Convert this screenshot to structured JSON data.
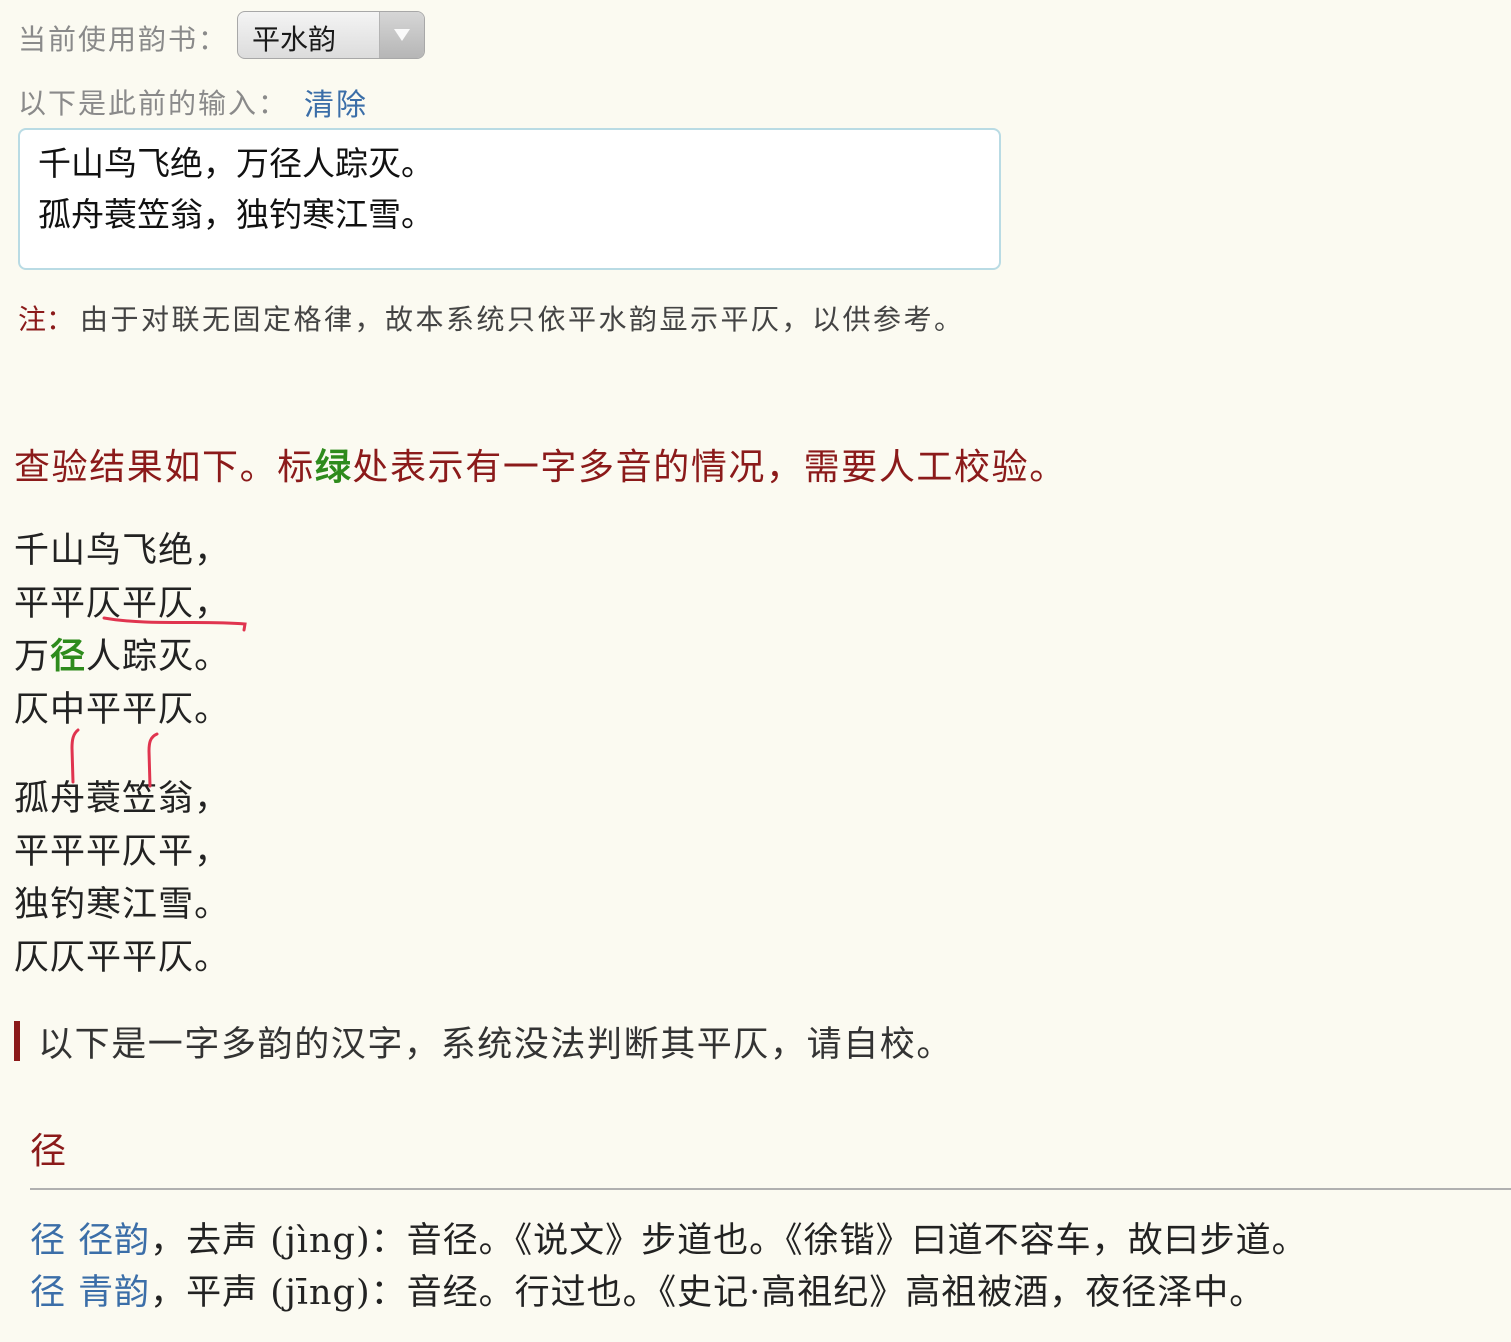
{
  "rhyme_book": {
    "label": "当前使用韵书：",
    "selected": "平水韵"
  },
  "previous_input": {
    "label": "以下是此前的输入：",
    "clear_link": "清除",
    "text": "千山鸟飞绝，万径人踪灭。\n孤舟蓑笠翁，独钓寒江雪。"
  },
  "note": {
    "label": "注：",
    "text": "由于对联无固定格律，故本系统只依平水韵显示平仄，以供参考。"
  },
  "result_heading": {
    "part1": "查验结果如下。标",
    "green_word": "绿",
    "part2": "处表示有一字多音的情况，需要人工校验。"
  },
  "results": [
    {
      "verse": [
        "千",
        "山",
        "鸟",
        "飞",
        "绝",
        "，"
      ],
      "tones": [
        "平",
        "平",
        "仄",
        "平",
        "仄",
        "，"
      ],
      "multi": []
    },
    {
      "verse": [
        "万",
        "径",
        "人",
        "踪",
        "灭",
        "。"
      ],
      "tones": [
        "仄",
        "中",
        "平",
        "平",
        "仄",
        "。"
      ],
      "multi": [
        1
      ]
    },
    {
      "verse": [
        "孤",
        "舟",
        "蓑",
        "笠",
        "翁",
        "，"
      ],
      "tones": [
        "平",
        "平",
        "平",
        "仄",
        "平",
        "，"
      ],
      "multi": []
    },
    {
      "verse": [
        "独",
        "钓",
        "寒",
        "江",
        "雪",
        "。"
      ],
      "tones": [
        "仄",
        "仄",
        "平",
        "平",
        "仄",
        "。"
      ],
      "multi": []
    }
  ],
  "multi_section": {
    "title": "以下是一字多韵的汉字，系统没法判断其平仄，请自校。",
    "char": "径",
    "definitions": [
      {
        "char": "径",
        "rhyme": "径韵",
        "rest": "，去声 (jìng)：音径。《说文》步道也。《徐锴》曰道不容车，故曰步道。"
      },
      {
        "char": "径",
        "rhyme": "青韵",
        "rest": "，平声 (jīng)：音经。行过也。《史记·高祖纪》高祖被酒，夜径泽中。"
      }
    ]
  },
  "colors": {
    "background": "#fbfaf1",
    "dark_red": "#8b1a1a",
    "link_blue": "#3b6ea8",
    "green": "#2e8b1c",
    "annotation_red": "#e0344f"
  }
}
